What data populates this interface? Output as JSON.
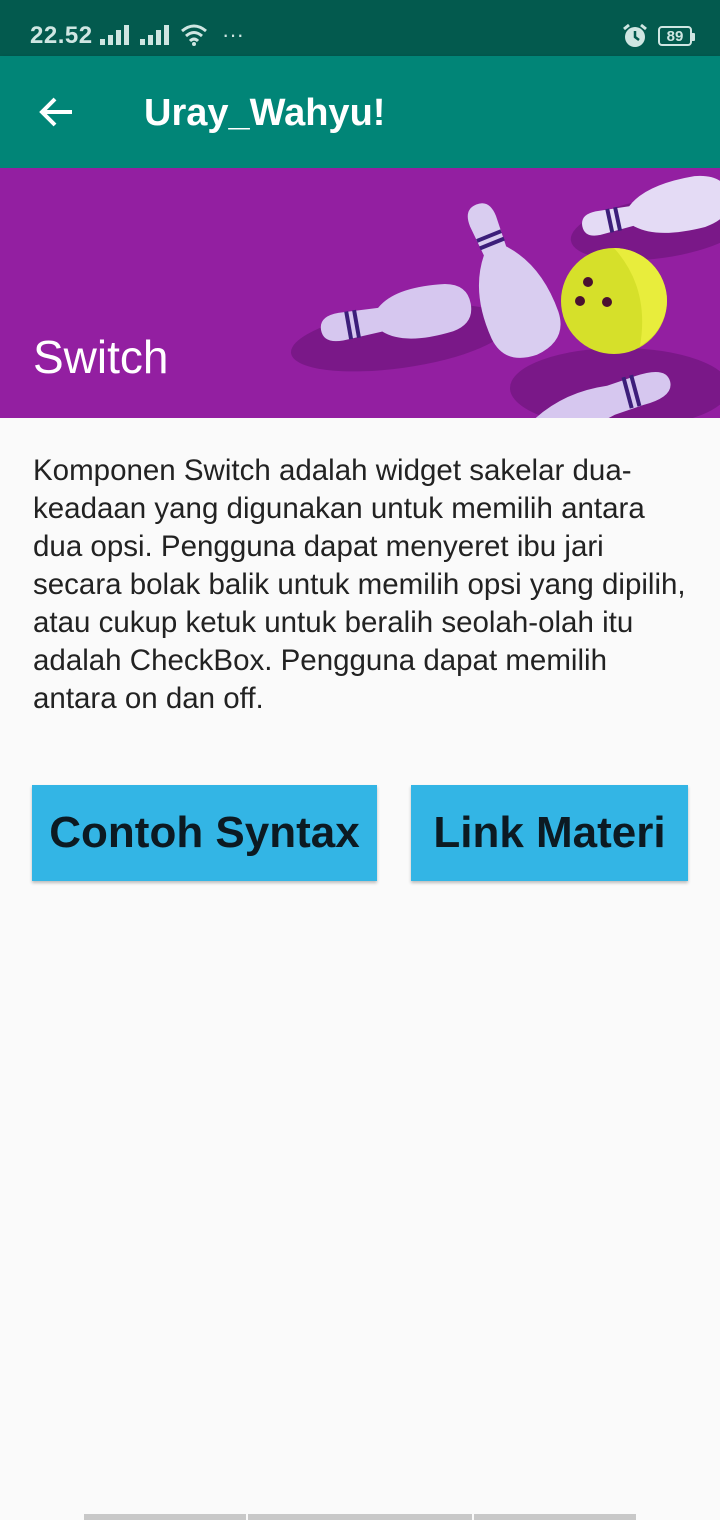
{
  "status_bar": {
    "time": "22.52",
    "battery": "89",
    "more": "···",
    "icons": [
      "signal-icon",
      "signal-icon",
      "wifi-icon",
      "alarm-icon",
      "battery-icon"
    ]
  },
  "app_bar": {
    "title": "Uray_Wahyu!",
    "back_icon": "arrow-back-icon"
  },
  "banner": {
    "title": "Switch"
  },
  "content": {
    "description": "Komponen Switch adalah widget sakelar dua-keadaan yang digunakan untuk memilih antara dua opsi. Pengguna dapat menyeret ibu jari secara bolak balik untuk memilih opsi yang dipilih, atau cukup ketuk untuk beralih seolah-olah itu adalah CheckBox. Pengguna dapat memilih antara on dan off."
  },
  "buttons": {
    "syntax_label": "Contoh Syntax",
    "link_label": "Link Materi"
  },
  "colors": {
    "status_bar": "#035a4e",
    "app_bar": "#018577",
    "banner": "#931fa1",
    "button": "#33b5e5"
  }
}
